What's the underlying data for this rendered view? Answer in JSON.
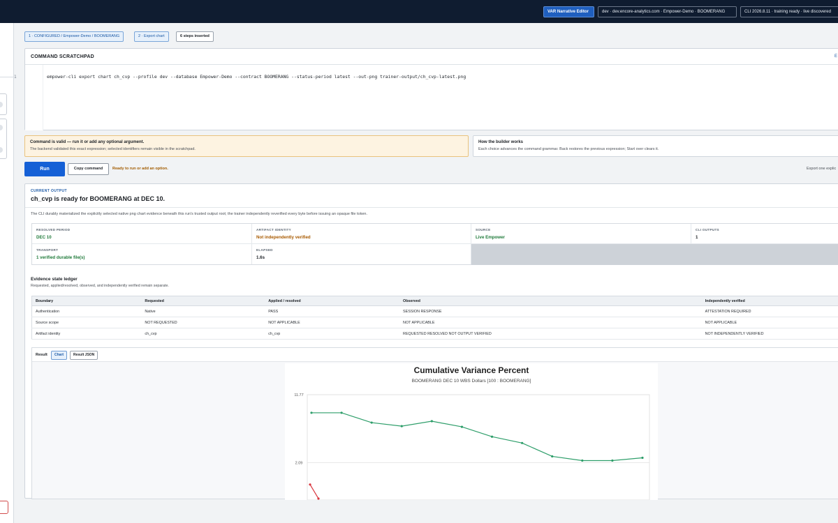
{
  "topbar": {
    "primary_badge": "VAR Narrative Editor",
    "env_badge": "dev · dev.encore-analytics.com · Empower-Demo · BOOMERANG",
    "cli_badge": "CLI 2026.8.11 · training ready · live discovered"
  },
  "breadcrumb": {
    "step1": "1 · CONFIGURED / Empower-Demo / BOOMERANG",
    "step2": "2 · Export chart",
    "steps_inserted": "6 steps inserted"
  },
  "scratchpad": {
    "title": "COMMAND SCRATCHPAD",
    "edge_link": "E",
    "line_number": "1",
    "command": "empower-cli export chart ch_cvp --profile dev --database Empower-Demo --contract BOOMERANG --status-period latest --out-png trainer-output/ch_cvp-latest.png"
  },
  "validation": {
    "title": "Command is valid — run it or add any optional argument.",
    "subtitle": "The backend validated this exact expression; selected identifiers remain visible in the scratchpad."
  },
  "how_builder": {
    "title": "How the builder works",
    "subtitle": "Each choice advances the command grammar. Back restores the previous expression; Start over clears it."
  },
  "actions": {
    "run_label": "Run",
    "copy_label": "Copy command",
    "ready_text": "Ready to run or add an option.",
    "export_hint": "Export one explic"
  },
  "output": {
    "kicker": "CURRENT OUTPUT",
    "title": "ch_cvp is ready for BOOMERANG at DEC 10.",
    "description": "The CLI durably materialized the explicitly selected native png chart evidence beneath this run's trusted output root; the trainer independently reverified every byte before issuing an opaque file token.",
    "metrics": {
      "resolved_period_label": "RESOLVED PERIOD",
      "resolved_period_value": "DEC 10",
      "artifact_identity_label": "ARTIFACT IDENTITY",
      "artifact_identity_value": "Not independently verified",
      "source_label": "SOURCE",
      "source_value": "Live Empower",
      "cli_outputs_label": "CLI OUTPUTS",
      "cli_outputs_value": "1",
      "transport_label": "TRANSPORT",
      "transport_value": "1 verified durable file(s)",
      "elapsed_label": "ELAPSED",
      "elapsed_value": "1.6s"
    },
    "ledger": {
      "title": "Evidence state ledger",
      "subtitle": "Requested, applied/resolved, observed, and independently verified remain separate.",
      "headers": [
        "Boundary",
        "Requested",
        "Applied / resolved",
        "Observed",
        "Independently verified"
      ],
      "rows": [
        [
          "Authentication",
          "Native",
          "PASS",
          "SESSION RESPONSE",
          "ATTESTATION REQUIRED"
        ],
        [
          "Source scope",
          "NOT REQUESTED",
          "NOT APPLICABLE",
          "NOT APPLICABLE",
          "NOT APPLICABLE"
        ],
        [
          "Artifact identity",
          "ch_cvp",
          "ch_cvp",
          "REQUESTED RESOLVED NOT OUTPUT VERIFIED",
          "NOT INDEPENDENTLY VERIFIED"
        ]
      ]
    },
    "result": {
      "label": "Result",
      "tab_chart": "Chart",
      "tab_json": "Result JSON"
    }
  },
  "colors": {
    "accent": "#1560d6",
    "series_green": "#2e9e6a",
    "series_red": "#d9363e"
  },
  "chart_data": {
    "type": "line",
    "title": "Cumulative Variance Percent",
    "subtitle": "BOOMERANG DEC 10 WBS Dollars [100 : BOOMERANG]",
    "y_tick_labels": [
      "11.77",
      "2.09"
    ],
    "y_ticks": [
      11.77,
      2.09
    ],
    "ylim": [
      -3.2,
      11.77
    ],
    "grid": true,
    "series": [
      {
        "color": "#2e9e6a",
        "values": [
          9.2,
          9.2,
          7.8,
          7.3,
          8.0,
          7.2,
          5.8,
          4.9,
          3.0,
          2.4,
          2.4,
          2.8
        ]
      },
      {
        "color": "#d9363e",
        "values": [
          -1.0,
          -3.0
        ]
      }
    ]
  }
}
